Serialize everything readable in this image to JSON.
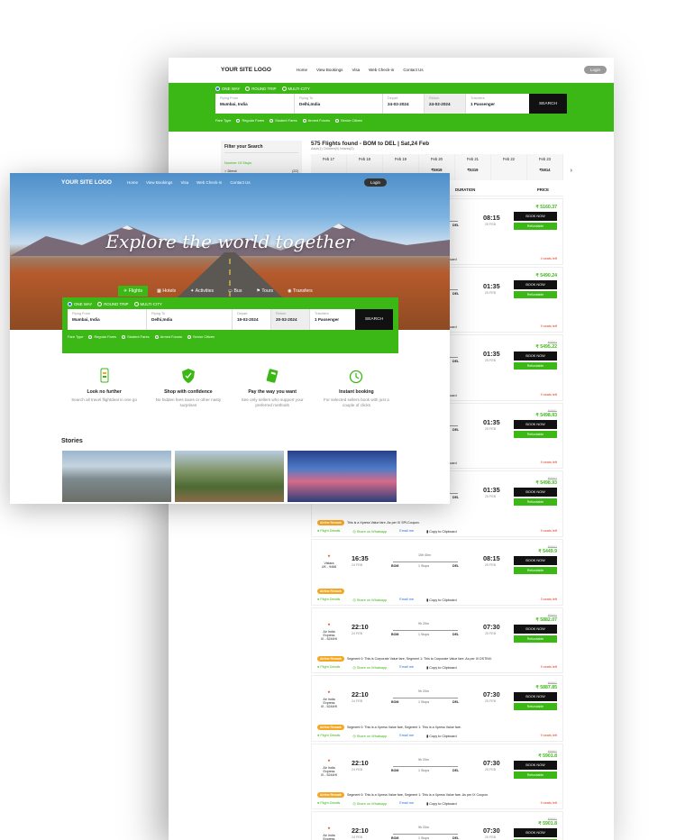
{
  "back": {
    "logo": "YOUR SITE LOGO",
    "nav": [
      "Home",
      "View Bookings",
      "Visa",
      "Web Check-in",
      "Contact Us"
    ],
    "login": "Login",
    "trip_types": [
      "ONE WAY",
      "ROUND TRIP",
      "MULTI-CITY"
    ],
    "search": {
      "from_label": "Flying From",
      "from": "Mumbai, India",
      "to_label": "Flying To",
      "to": "Delhi,India",
      "depart_label": "Depart",
      "depart": "24-02-2024",
      "return_label": "Return",
      "return": "24-02-2024",
      "travelers_label": "Travelers",
      "travelers": "1 Passenger",
      "button": "SEARCH"
    },
    "fare_type_label": "Fare Type",
    "fare_types": [
      "Regular Fares",
      "Student Fares",
      "Armed Forces",
      "Senior Citizen"
    ],
    "filter": {
      "title": "Filter your Search",
      "stops_label": "Number Of Stops",
      "direct": "Direct",
      "direct_count": "(22)"
    },
    "results": {
      "title": "575 Flights found - BOM to DEL  |  Sat,24 Feb",
      "subtitle": "Adult(1) Children(0) Infants(0)",
      "dates": [
        {
          "d": "Feb 17",
          "p": ""
        },
        {
          "d": "Feb 18",
          "p": ""
        },
        {
          "d": "Feb 19",
          "p": ""
        },
        {
          "d": "Feb 20",
          "p": "₹5919"
        },
        {
          "d": "Feb 21",
          "p": "₹5319"
        },
        {
          "d": "Feb 22",
          "p": ""
        },
        {
          "d": "Feb 23",
          "p": "₹5814"
        }
      ],
      "col_duration": "DURATION",
      "col_price": "PRICE"
    },
    "flights": [
      {
        "airline": "",
        "code": "",
        "dep": "",
        "dep_date": "",
        "arr": "08:15",
        "arr_date": "25 FEB",
        "dur": "",
        "stops": "",
        "old": "",
        "price": "₹ 5160.37",
        "offer_tag": "",
        "offer": "",
        "seats": "4 seats left"
      },
      {
        "airline": "",
        "code": "",
        "dep": "",
        "dep_date": "",
        "arr": "01:35",
        "arr_date": "25 FEB",
        "dur": "",
        "stops": "",
        "old": "",
        "price": "₹ 5490.24",
        "offer_tag": "",
        "offer": "",
        "seats": "9 seats left"
      },
      {
        "airline": "",
        "code": "",
        "dep": "",
        "dep_date": "",
        "arr": "01:35",
        "arr_date": "25 FEB",
        "dur": "",
        "stops": "",
        "old": "₹5661",
        "price": "₹ 5495.22",
        "offer_tag": "",
        "offer": "",
        "seats": "9 seats left"
      },
      {
        "airline": "",
        "code": "",
        "dep": "",
        "dep_date": "",
        "arr": "01:35",
        "arr_date": "25 FEB",
        "dur": "",
        "stops": "",
        "old": "₹5661",
        "price": "₹ 5498.93",
        "offer_tag": "",
        "offer": "",
        "seats": "9 seats left"
      },
      {
        "airline": "",
        "code": "",
        "dep": "",
        "dep_date": "",
        "arr": "01:35",
        "arr_date": "25 FEB",
        "dur": "",
        "stops": "",
        "old": "₹5661",
        "price": "₹ 5498.93",
        "offer_tag": "Airline Remark",
        "offer": "This is a Xpress Value fare. As per IX SPLCoupon.",
        "seats": "9 seats left"
      },
      {
        "airline": "Vistara",
        "code": "UK - 9468",
        "dep": "16:35",
        "dep_date": "24 FEB",
        "arr": "08:15",
        "arr_date": "25 FEB",
        "dur": "15h 40m",
        "stops": "1 Stops",
        "old": "₹5661",
        "price": "₹ 5449.9",
        "offer_tag": "Airline Remark",
        "offer": "",
        "seats": "3 seats left"
      },
      {
        "airline": "Air India Express",
        "code": "IX - 5244HI",
        "dep": "22:10",
        "dep_date": "24 FEB",
        "arr": "07:30",
        "arr_date": "25 FEB",
        "dur": "9h 20m",
        "stops": "1 Stops",
        "old": "₹5661",
        "price": "₹ 5882.07",
        "offer_tag": "Airline Remark",
        "offer": "Segment 0: This is Corporate Value fare, Segment 1: This is Corporate Value fare. As per IX DSTINV.",
        "seats": "9 seats left"
      },
      {
        "airline": "Air India Express",
        "code": "IX - 5244HI",
        "dep": "22:10",
        "dep_date": "24 FEB",
        "arr": "07:30",
        "arr_date": "25 FEB",
        "dur": "9h 20m",
        "stops": "1 Stops",
        "old": "₹5661",
        "price": "₹ 5887.85",
        "offer_tag": "Airline Remark",
        "offer": "Segment 0: This is a Xpress Value fare, Segment 1: This is a Xpress Value fare.",
        "seats": "9 seats left"
      },
      {
        "airline": "Air India Express",
        "code": "IX - 5244HI",
        "dep": "22:10",
        "dep_date": "24 FEB",
        "arr": "07:30",
        "arr_date": "25 FEB",
        "dur": "9h 20m",
        "stops": "1 Stops",
        "old": "₹5661",
        "price": "₹ 5901.8",
        "offer_tag": "Airline Remark",
        "offer": "Segment 0: This is a Xpress Value fare, Segment 1: This is a Xpress Value fare. As per IX Coupon.",
        "seats": "9 seats left"
      },
      {
        "airline": "Air India Express",
        "code": "IX - 5244HI",
        "dep": "22:10",
        "dep_date": "24 FEB",
        "arr": "07:30",
        "arr_date": "25 FEB",
        "dur": "9h 20m",
        "stops": "1 Stops",
        "old": "₹5661",
        "price": "₹ 5901.8",
        "offer_tag": "",
        "offer": "",
        "seats": ""
      }
    ],
    "flight_details": "Flight Details",
    "share": "Share on Whatsapp",
    "email": "Email me",
    "copy": "Copy to Clipboard",
    "book": "BOOK NOW",
    "refundable": "Refundable"
  },
  "front": {
    "logo": "YOUR SITE LOGO",
    "nav": [
      "Home",
      "View Bookings",
      "Visa",
      "Web Check-in",
      "Contact Us"
    ],
    "login": "Login",
    "headline": "Explore the world together",
    "tabs": [
      "Flights",
      "Hotels",
      "Activities",
      "Bus",
      "Tours",
      "Transfers"
    ],
    "trip_types": [
      "ONE WAY",
      "ROUND TRIP",
      "MULTI-CITY"
    ],
    "search": {
      "from_label": "Flying From",
      "from": "Mumbai, India",
      "to_label": "Flying To",
      "to": "Delhi,India",
      "depart_label": "Depart",
      "depart": "19-02-2024",
      "return_label": "Return",
      "return": "20-02-2024",
      "travelers_label": "Travelers",
      "travelers": "1 Passenger",
      "button": "SEARCH"
    },
    "fare_type_label": "Fare Type",
    "fare_types": [
      "Regular Fares",
      "Student Fares",
      "Armed Forces",
      "Senior Citizen"
    ],
    "features": [
      {
        "title": "Look no further",
        "desc": "Search all travel flightdeal in one go"
      },
      {
        "title": "Shop with confidence",
        "desc": "No hidden fees taxes or other nasty surprises"
      },
      {
        "title": "Pay the way you want",
        "desc": "See only sellers who support your preferred methods"
      },
      {
        "title": "Instant booking",
        "desc": "For selected sellers book with just a couple of clicks"
      }
    ],
    "stories_title": "Stories"
  },
  "colors": {
    "brand_green": "#3cb816",
    "dark": "#111111",
    "seats_red": "#e23b1a",
    "remark_orange": "#f5a623"
  }
}
